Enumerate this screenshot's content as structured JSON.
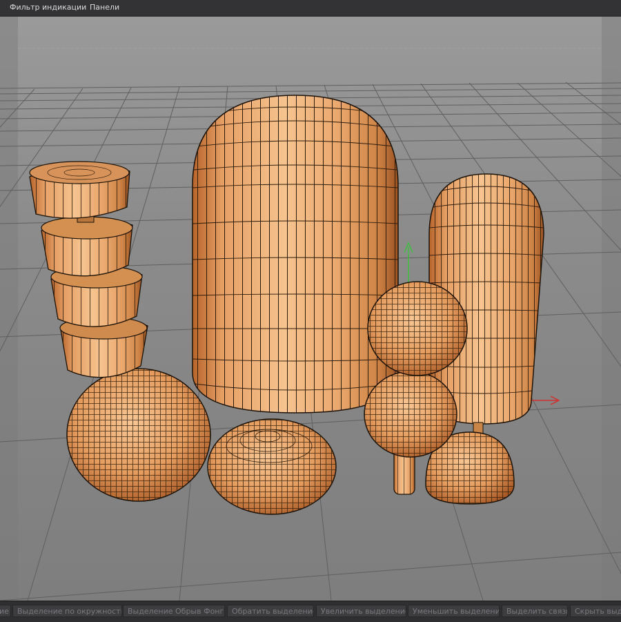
{
  "menu": {
    "items": [
      "Фильтр индикации",
      "Панели"
    ]
  },
  "toolbar": {
    "buttons": [
      "ие",
      "Выделение по окружности",
      "Выделение Обрыв Фонга",
      "Обратить выделение",
      "Увеличить выделение",
      "Уменьшить выделение",
      "Выделить связь",
      "Скрыть выде"
    ]
  },
  "colors": {
    "viewport_bg": "#8a8a8a",
    "grid_line": "#5c5c5c",
    "wood_light": "#f0b07a",
    "wood_dark": "#c06a2e",
    "wireframe": "#1a1208",
    "axis_y": "#3cbf3c",
    "axis_x": "#d03030"
  },
  "icons": [
    "axis-gizmo-icon"
  ]
}
